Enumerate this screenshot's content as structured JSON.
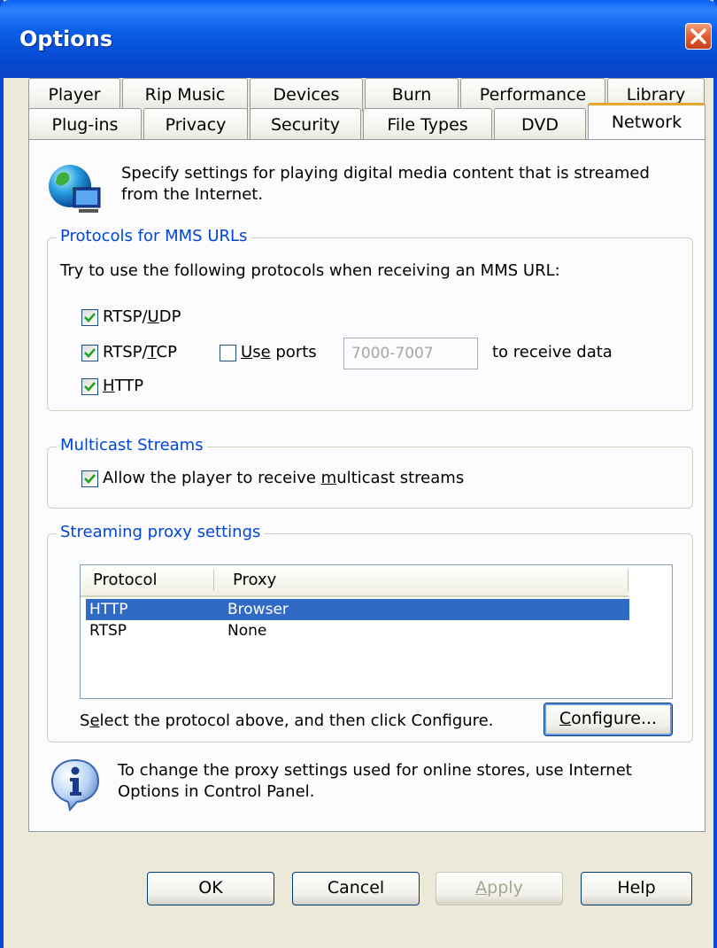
{
  "window": {
    "title": "Options"
  },
  "tabs": {
    "back_row": [
      "Player",
      "Rip Music",
      "Devices",
      "Burn",
      "Performance",
      "Library"
    ],
    "front_row": [
      "Plug-ins",
      "Privacy",
      "Security",
      "File Types",
      "DVD",
      "Network"
    ],
    "active": "Network"
  },
  "intro": {
    "text": "Specify settings for playing digital media content that is streamed from the Internet."
  },
  "protocols": {
    "title": "Protocols for MMS URLs",
    "instruction": "Try to use the following protocols when receiving an MMS URL:",
    "rtsp_udp": {
      "label_prefix": "RTSP/",
      "label_mnemonic": "U",
      "label_suffix": "DP",
      "checked": true
    },
    "rtsp_tcp": {
      "label_prefix": "RTSP/",
      "label_mnemonic": "T",
      "label_suffix": "CP",
      "checked": true
    },
    "use_ports": {
      "label_mnemonic": "U",
      "label_mid": "s",
      "label_mnemonic2": "e",
      "label_suffix": " ports",
      "checked": false
    },
    "ports_value": "7000-7007",
    "receive_label": "to receive data",
    "http": {
      "label_mnemonic": "H",
      "label_suffix": "TTP",
      "checked": true
    }
  },
  "multicast": {
    "title": "Multicast Streams",
    "allow": {
      "label_prefix": "Allow the player to receive ",
      "label_mnemonic": "m",
      "label_suffix": "ulticast streams",
      "checked": true
    }
  },
  "proxy": {
    "title": "Streaming proxy settings",
    "columns": [
      "Protocol",
      "Proxy"
    ],
    "rows": [
      {
        "protocol": "HTTP",
        "proxy": "Browser",
        "selected": true
      },
      {
        "protocol": "RTSP",
        "proxy": "None",
        "selected": false
      }
    ],
    "hint_prefix": "S",
    "hint_mnemonic": "e",
    "hint_suffix": "lect the protocol above, and then click Configure.",
    "configure_mnemonic": "C",
    "configure_suffix": "onfigure..."
  },
  "info": {
    "text": "To change the proxy settings used for online stores, use Internet Options in Control Panel."
  },
  "buttons": {
    "ok": "OK",
    "cancel": "Cancel",
    "apply_mnemonic": "A",
    "apply_suffix": "pply",
    "help": "Help"
  },
  "colors": {
    "titlebar": "#0a5ee6",
    "selection": "#316ac5",
    "group_title": "#0046d5",
    "active_tab_accent": "#e8a530"
  }
}
